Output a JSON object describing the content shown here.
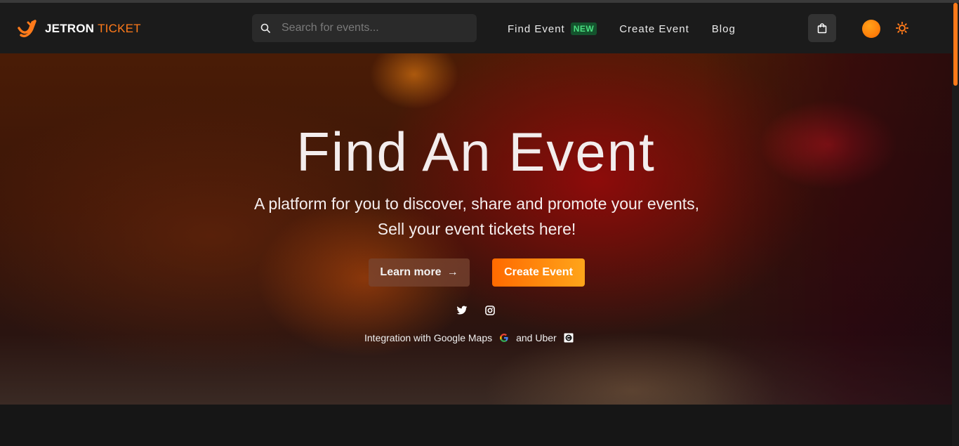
{
  "brand": {
    "name_bold": "JETRON",
    "name_light": "TICKET",
    "logo_icon": "jetron-logo-icon",
    "accent": "#ff7a1a"
  },
  "search": {
    "placeholder": "Search for events...",
    "icon": "search-icon"
  },
  "nav": {
    "find_event": "Find Event",
    "new_badge": "NEW",
    "create_event": "Create Event",
    "blog": "Blog"
  },
  "header_actions": {
    "cart_icon": "shopping-bag-icon",
    "avatar": "user-avatar",
    "theme_icon": "sun-icon"
  },
  "hero": {
    "title": "Find An Event",
    "subtitle": "A platform for you to discover, share and promote your events, Sell your event tickets here!",
    "learn_more": "Learn more",
    "learn_more_arrow": "→",
    "create_event": "Create Event",
    "social_icons": [
      "twitter-icon",
      "instagram-icon"
    ],
    "integration_text_1": "Integration with Google Maps",
    "integration_text_2": "and Uber",
    "integration_icons": [
      "google-icon",
      "uber-icon"
    ]
  },
  "colors": {
    "navbar_bg": "#1b1b1b",
    "page_bg": "#161616",
    "primary": "#ff7a1a",
    "badge_bg": "#14532d",
    "badge_text": "#4ade80"
  }
}
